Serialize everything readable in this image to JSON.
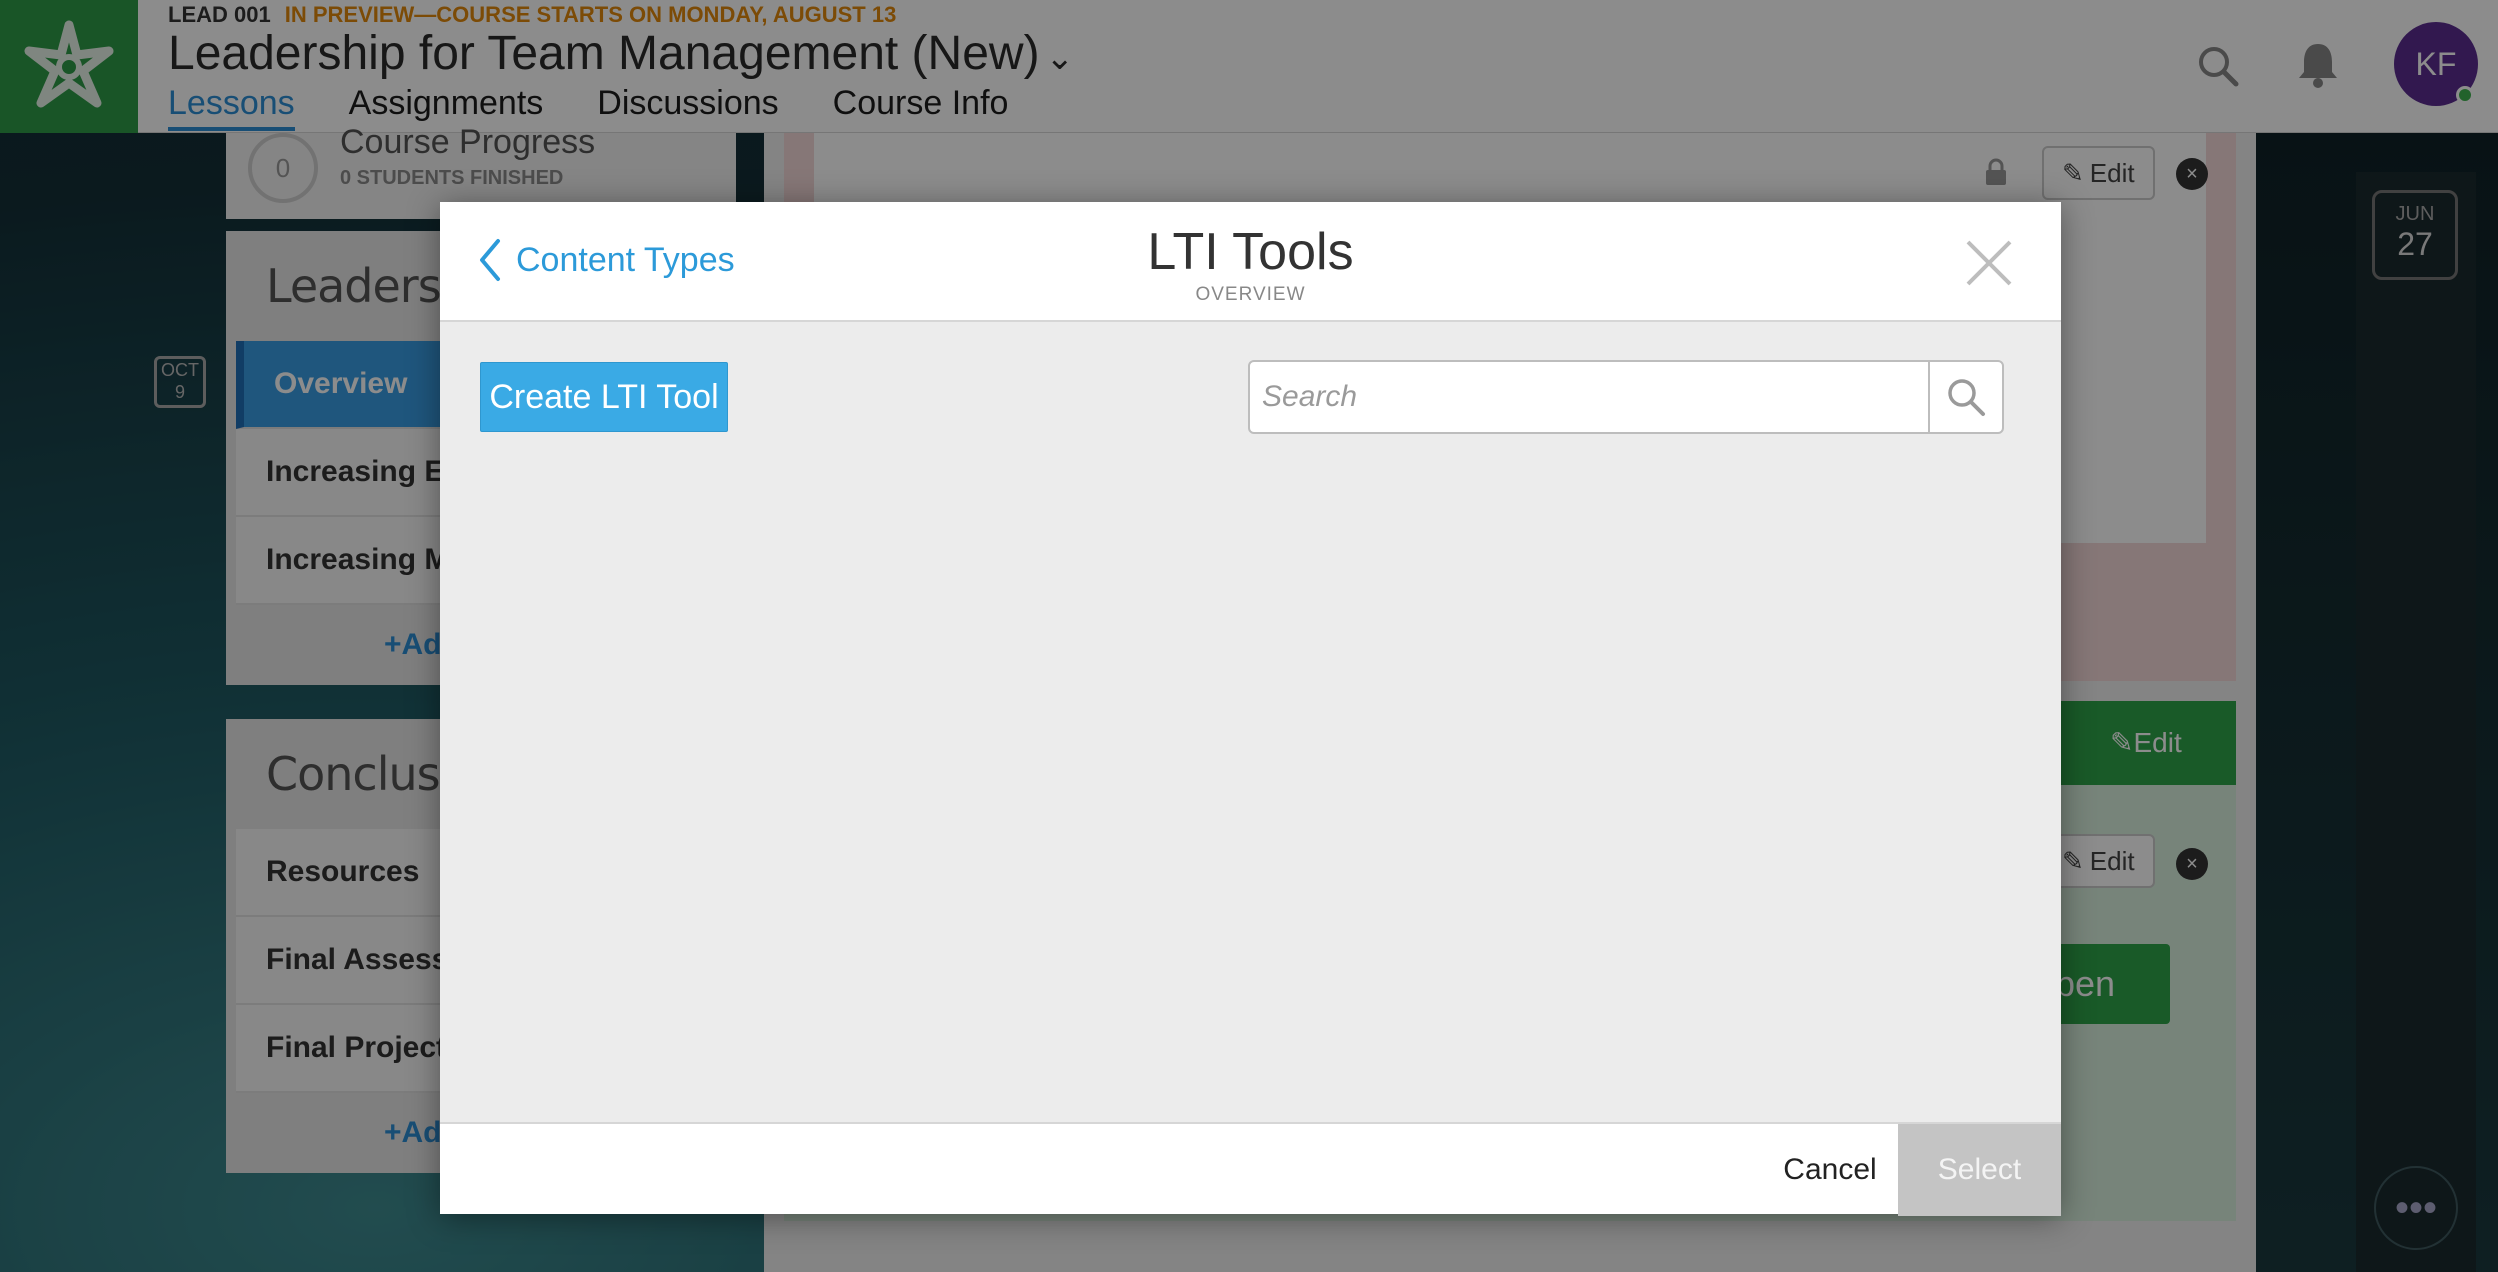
{
  "header": {
    "course_code": "LEAD 001",
    "preview_note": "IN PREVIEW—COURSE STARTS ON MONDAY, AUGUST 13",
    "course_title": "Leadership for Team Management (New)",
    "nav": [
      "Lessons",
      "Assignments",
      "Discussions",
      "Course Info"
    ],
    "avatar_initials": "KF"
  },
  "left_panel": {
    "progress_value": "0",
    "progress_title": "Course Progress",
    "progress_sub": "0 STUDENTS FINISHED",
    "sections": [
      {
        "title": "Leadership",
        "lessons": [
          "Overview",
          "Increasing Ef",
          "Increasing M"
        ],
        "add_label": "+Ad"
      },
      {
        "title": "Conclusion",
        "lessons": [
          "Resources",
          "Final Assessn",
          "Final Project"
        ],
        "add_label": "+Ad"
      }
    ],
    "date_badge": {
      "month": "OCT",
      "day": "9"
    }
  },
  "content": {
    "edit_label": "Edit",
    "open_label": "pen"
  },
  "right_rail": {
    "date_badge": {
      "month": "JUN",
      "day": "27"
    },
    "more_label": "•••"
  },
  "modal": {
    "back_label": "Content Types",
    "title": "LTI Tools",
    "subtitle": "OVERVIEW",
    "create_label": "Create LTI Tool",
    "search_placeholder": "Search",
    "cancel_label": "Cancel",
    "select_label": "Select"
  },
  "colors": {
    "accent_blue": "#3aaae5",
    "link_blue": "#2c9ad9",
    "brand_green": "#2f9b47",
    "preview_orange": "#e2890c",
    "avatar_purple": "#5b2d91",
    "disabled_gray": "#c4c4c4"
  },
  "icons": [
    "chevron-left-icon",
    "close-icon",
    "search-icon",
    "bell-icon",
    "chevron-down-icon",
    "pencil-icon",
    "lock-icon"
  ]
}
